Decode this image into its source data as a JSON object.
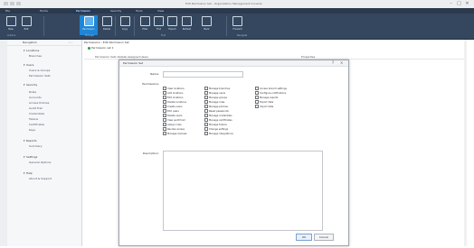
{
  "window": {
    "title": "Edit Permission Set - Organization Management Console",
    "controls": [
      "–",
      "□",
      "✕"
    ]
  },
  "ribbon_tabs": [
    "File",
    "Home",
    "Permission",
    "Security",
    "Tools",
    "View"
  ],
  "ribbon": {
    "buttons": [
      {
        "label": "New",
        "icon": "new-icon"
      },
      {
        "label": "Edit",
        "icon": "edit-icon"
      },
      {
        "label": "Permission",
        "icon": "permission-icon"
      },
      {
        "label": "Delete",
        "icon": "delete-icon"
      },
      {
        "label": "Copy",
        "icon": "copy-icon"
      },
      {
        "label": "Filter",
        "icon": "filter-icon"
      },
      {
        "label": "Find",
        "icon": "find-icon"
      },
      {
        "label": "Export",
        "icon": "export-icon"
      },
      {
        "label": "Refresh",
        "icon": "refresh-icon"
      },
      {
        "label": "Back",
        "icon": "back-icon"
      },
      {
        "label": "Forward",
        "icon": "forward-icon"
      }
    ],
    "groups": [
      "Actions",
      "Manage",
      "Find",
      "Navigate"
    ]
  },
  "leftnav": {
    "title": "Navigation",
    "collapse": "« ‹",
    "sections": [
      {
        "label": "Locations",
        "items": [
          "Branches"
        ]
      },
      {
        "label": "Users",
        "items": [
          "Users & Groups",
          "Permission Sets"
        ]
      },
      {
        "label": "Security",
        "items": [
          "Roles",
          "Accounts",
          "Access Policies",
          "Audit Trail",
          "Credentials",
          "Tokens",
          "Certificates",
          "Keys"
        ]
      },
      {
        "label": "Reports",
        "items": [
          "Summary"
        ]
      },
      {
        "label": "Settings",
        "items": [
          "General Options"
        ]
      },
      {
        "label": "Help",
        "items": [
          "About & Support"
        ]
      }
    ]
  },
  "breadcrumb": "Permissions › Edit Permission Set",
  "doc_item": "Permission set 1",
  "toolbar": {
    "left": "Permission Sets   Details   Assigned Users",
    "right": "Properties"
  },
  "dialog": {
    "title": "Permission Set",
    "name_label": "Name:",
    "permissions_label": "Permissions:",
    "description_label": "Description:",
    "permissions": [
      [
        "View locations",
        "Manage branches",
        "Access branch settings"
      ],
      [
        "Add locations",
        "Manage users",
        "Configure notifications"
      ],
      [
        "Edit locations",
        "Manage groups",
        "Manage reports"
      ],
      [
        "Delete locations",
        "Manage roles",
        "Export data"
      ],
      [
        "Create users",
        "Manage policies",
        "Import data"
      ],
      [
        "Edit users",
        "Reset passwords",
        ""
      ],
      [
        "Delete users",
        "Manage credentials",
        ""
      ],
      [
        "View audit trail",
        "Manage certificates",
        ""
      ],
      [
        "Assign roles",
        "Manage tokens",
        ""
      ],
      [
        "Revoke access",
        "Change settings",
        ""
      ],
      [
        "Manage licenses",
        "Manage integrations",
        ""
      ]
    ],
    "ok": "OK",
    "cancel": "Cancel"
  }
}
